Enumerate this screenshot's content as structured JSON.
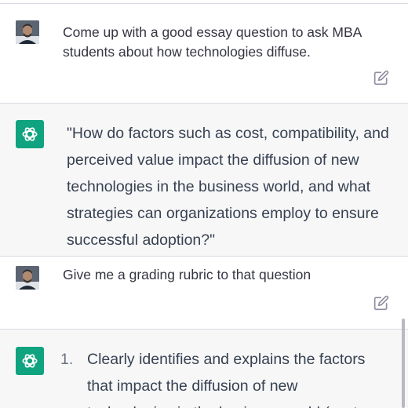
{
  "messages": [
    {
      "role": "user",
      "text": "Come up with a good essay question to ask MBA students about how technologies diffuse."
    },
    {
      "role": "assistant",
      "text": "\"How do factors such as cost, compatibility, and perceived value impact the diffusion of new technologies in the business world, and what strategies can organizations employ to ensure successful adoption?\""
    },
    {
      "role": "user",
      "text": "Give me a grading rubric to that question"
    },
    {
      "role": "assistant",
      "list_number": "1.",
      "list_text": "Clearly identifies and explains the factors that impact the diffusion of new technologies in the business world (cost,"
    }
  ],
  "icons": {
    "edit": "edit-icon",
    "assistant_logo": "openai-logo",
    "user_avatar": "user-avatar"
  },
  "colors": {
    "assistant_bg": "#f7f7f8",
    "user_bg": "#ffffff",
    "assistant_logo_bg": "#10a37f"
  }
}
